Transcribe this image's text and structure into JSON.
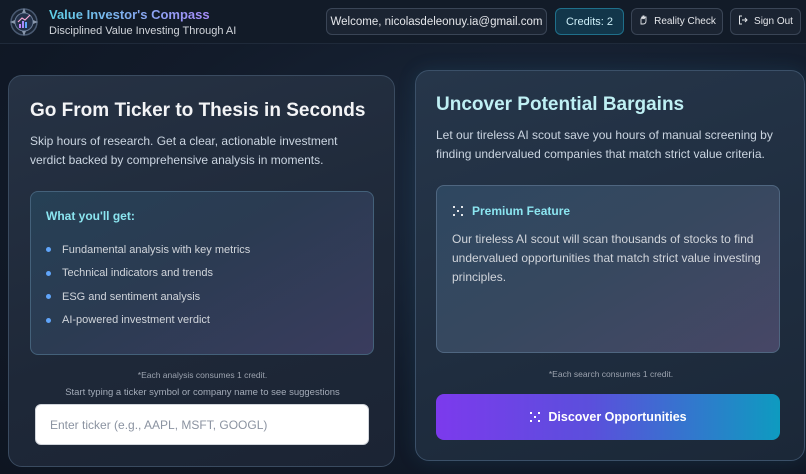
{
  "header": {
    "title": "Value Investor's Compass",
    "subtitle": "Disciplined Value Investing Through AI",
    "welcome": "Welcome, nicolasdeleonuy.ia@gmail.com",
    "credits": "Credits: 2",
    "reality_check": "Reality Check",
    "sign_out": "Sign Out",
    "logo_icon": "compass-chart-logo",
    "reality_icon": "hand-icon",
    "signout_icon": "sign-out-icon"
  },
  "analysis": {
    "heading": "Go From Ticker to Thesis in Seconds",
    "description": "Skip hours of research. Get a clear, actionable investment verdict backed by comprehensive analysis in moments.",
    "features_title": "What you'll get:",
    "features": [
      "Fundamental analysis with key metrics",
      "Technical indicators and trends",
      "ESG and sentiment analysis",
      "AI-powered investment verdict"
    ],
    "credit_note": "*Each analysis consumes 1 credit.",
    "hint": "Start typing a ticker symbol or company name to see suggestions",
    "input_placeholder": "Enter ticker (e.g., AAPL, MSFT, GOOGL)",
    "input_value": ""
  },
  "bargains": {
    "heading": "Uncover Potential Bargains",
    "description": "Let our tireless AI scout save you hours of manual screening by finding undervalued companies that match strict value criteria.",
    "premium_title": "Premium Feature",
    "premium_text": "Our tireless AI scout will scan thousands of stocks to find undervalued opportunities that match strict value investing principles.",
    "credit_note": "*Each search consumes 1 credit.",
    "button_label": "Discover Opportunities"
  },
  "colors": {
    "accent_cyan": "#8be5f0",
    "button_gradient_start": "#7c3aed",
    "button_gradient_end": "#0e9bc0",
    "bullet": "#60a5fa"
  }
}
